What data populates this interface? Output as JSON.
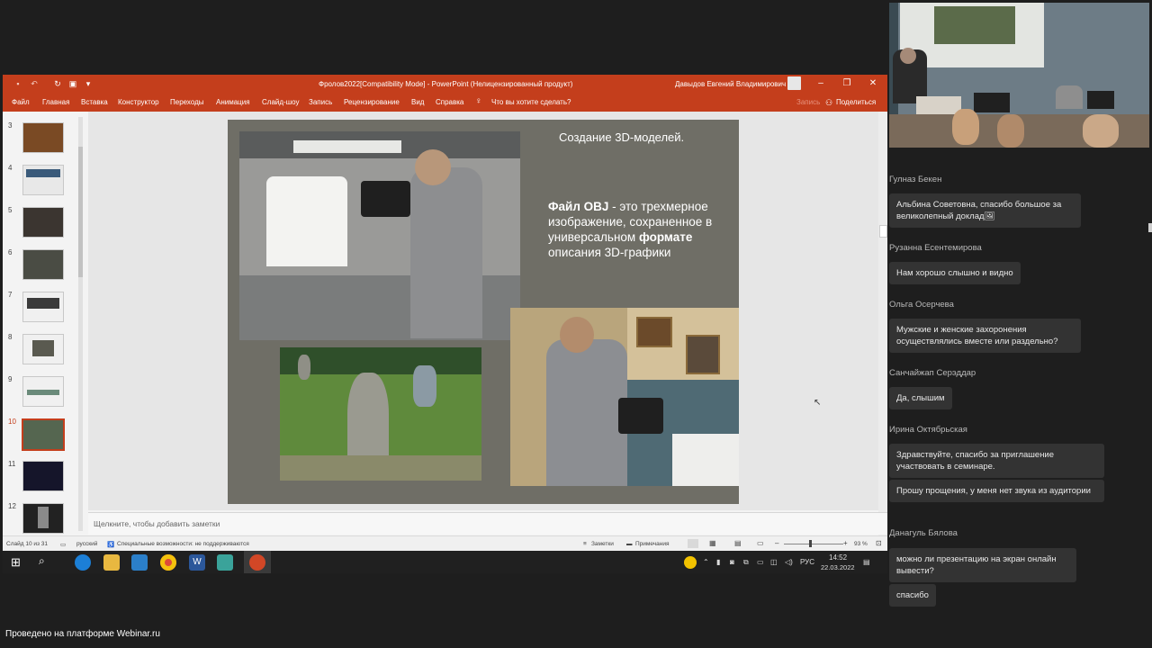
{
  "window": {
    "title": "Фролов2022[Compatibility Mode]  -  PowerPoint (Нелицензированный продукт)",
    "user": "Давыдов Евгений Владимирович"
  },
  "menu": {
    "items": [
      "Файл",
      "Главная",
      "Вставка",
      "Конструктор",
      "Переходы",
      "Анимация",
      "Слайд-шоу",
      "Запись",
      "Рецензирование",
      "Вид",
      "Справка"
    ],
    "tell_me": "Что вы хотите сделать?",
    "record": "Запись",
    "share": "Поделиться"
  },
  "thumbnails": [
    {
      "num": "3"
    },
    {
      "num": "4"
    },
    {
      "num": "5"
    },
    {
      "num": "6"
    },
    {
      "num": "7"
    },
    {
      "num": "8"
    },
    {
      "num": "9"
    },
    {
      "num": "10"
    },
    {
      "num": "11"
    },
    {
      "num": "12"
    }
  ],
  "active_slide": "10",
  "slide": {
    "title": "Создание 3D-моделей.",
    "body_bold1": "Файл OBJ",
    "body_part1": " - это трехмерное изображение, сохраненное в универсальном ",
    "body_bold2": "формате",
    "body_part2": " описания 3D-графики"
  },
  "notes_placeholder": "Щелкните, чтобы добавить заметки",
  "status": {
    "slide_count": "Слайд 10 из 31",
    "language": "русский",
    "accessibility": "Специальные возможности: не поддерживаются",
    "notes": "Заметки",
    "comments": "Примечания",
    "zoom": "93 %"
  },
  "taskbar": {
    "lang": "РУС",
    "time": "14:52",
    "date": "22.03.2022"
  },
  "chat": [
    {
      "author": "Гулназ Бекен",
      "messages": [
        "Альбина Советовна, спасибо большое за великолепный доклад🖼"
      ]
    },
    {
      "author": "Рузанна Есентемирова",
      "messages": [
        "Нам хорошо слышно и видно"
      ]
    },
    {
      "author": "Ольга Осерчева",
      "messages": [
        "Мужские и женские захоронения осуществлялись вместе или раздельно?"
      ]
    },
    {
      "author": "Санчайжап Серэддар",
      "messages": [
        "Да, слышим"
      ]
    },
    {
      "author": "Ирина Октябрьская",
      "messages": [
        "Здравствуйте, спасибо за приглашение участвовать в семинаре.",
        "Прошу прощения, у меня нет звука из аудитории"
      ]
    },
    {
      "author": "Данагуль Бялова",
      "messages": [
        "можно ли презентацию на экран онлайн вывести?",
        "спасибо"
      ]
    }
  ],
  "footer": "Проведено на платформе Webinar.ru",
  "colors": {
    "ppt_accent": "#c43e1c",
    "slide_bg": "#6f6e66",
    "chat_bubble": "#333333"
  }
}
